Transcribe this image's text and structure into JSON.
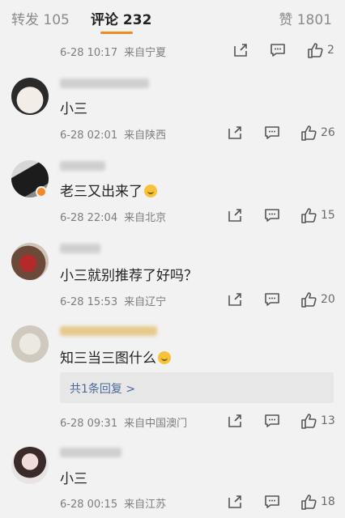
{
  "tabs": {
    "repost": "转发 105",
    "comments": "评论 232",
    "likes": "赞 1801"
  },
  "colors": {
    "accent": "#f18a1f",
    "link": "#4a6a9a",
    "meta": "#7d7d7d"
  },
  "comments": [
    {
      "text": "",
      "time": "6-28 10:17",
      "source": "来自宁夏",
      "likes": "2"
    },
    {
      "text": "小三",
      "time": "6-28 02:01",
      "source": "来自陕西",
      "likes": "26"
    },
    {
      "text": "老三又出来了",
      "emoji": "smile-emoji",
      "time": "6-28 22:04",
      "source": "来自北京",
      "likes": "15"
    },
    {
      "text": "小三就别推荐了好吗？",
      "time": "6-28 15:53",
      "source": "来自辽宁",
      "likes": "20"
    },
    {
      "text": "知三当三图什么",
      "emoji": "surprised-emoji",
      "time": "6-28 09:31",
      "source": "来自中国澳门",
      "likes": "13",
      "reply": "共1条回复 >"
    },
    {
      "text": "小三",
      "time": "6-28 00:15",
      "source": "来自江苏",
      "likes": "18"
    }
  ],
  "icons": {
    "share": "share-icon",
    "comment": "comment-icon",
    "like": "thumbs-up-icon"
  }
}
